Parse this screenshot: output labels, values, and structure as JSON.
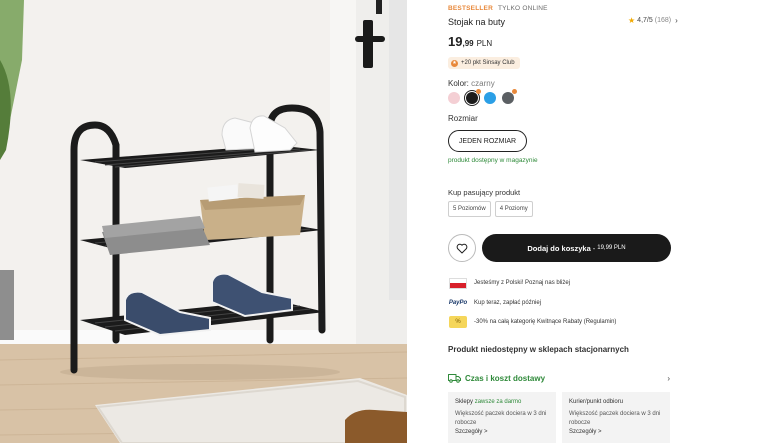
{
  "product": {
    "bestseller_label": "BESTSELLER",
    "online_label": "TYLKO ONLINE",
    "title": "Stojak na buty",
    "rating": "4,7/5",
    "rating_count": "(168)",
    "price_int": "19",
    "price_dec": ",99",
    "currency": "PLN",
    "club_badge": "+20 pkt Sinsay Club",
    "color_label": "Kolor:",
    "color_value": "czarny",
    "swatch_colors": [
      "#f4cfd4",
      "#1c1c1c",
      "#2b9fe6",
      "#5b5f63"
    ],
    "size_label": "Rozmiar",
    "size_value": "JEDEN ROZMIAR",
    "availability": "produkt dostępny w magazynie"
  },
  "matching": {
    "label": "Kup pasujący produkt",
    "options": [
      "5 Poziomów",
      "4 Poziomy"
    ]
  },
  "cart": {
    "add_label": "Dodaj do koszyka",
    "separator": "-",
    "price": "19,99 PLN"
  },
  "info": {
    "polish_company": "Jesteśmy z Polski! Poznaj nas bliżej",
    "paypo_logo": "PayPo",
    "paypo_text": "Kup teraz, zapłać później",
    "discount_text": "-30% na całą kategorię Kwitnące Rabaty (Regulamin)"
  },
  "store": {
    "unavailable": "Produkt niedostępny w sklepach stacjonarnych"
  },
  "delivery": {
    "label": "Czas i koszt dostawy",
    "cards": [
      {
        "title": "Sklepy",
        "title_extra": "zawsze za darmo",
        "desc": "Większość paczek dociera w 3 dni robocze",
        "more": "Szczegóły >"
      },
      {
        "title": "Kurier/punkt odbioru",
        "title_extra": "",
        "desc": "Większość paczek dociera w 3 dni robocze",
        "more": "Szczegóły >"
      }
    ]
  },
  "colors": {
    "accent_orange": "#e8883a",
    "green": "#2f8a3a",
    "dark_button": "#1a1a1a"
  }
}
